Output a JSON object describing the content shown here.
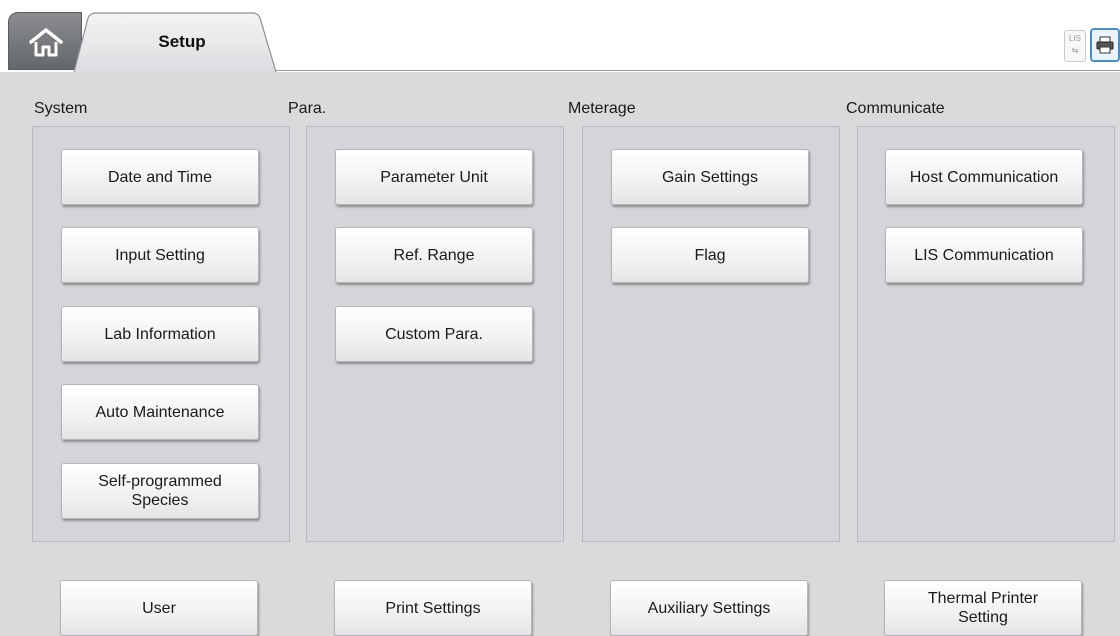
{
  "tabs": {
    "home_icon": "home-icon",
    "active_label": "Setup"
  },
  "toolbar": {
    "lis_label": "LIS",
    "lis_icon": "lis-transfer-icon",
    "printer_icon": "printer-icon"
  },
  "sections": {
    "system": {
      "title": "System",
      "buttons": [
        "Date and Time",
        "Input Setting",
        "Lab Information",
        "Auto Maintenance",
        "Self-programmed\nSpecies"
      ]
    },
    "para": {
      "title": "Para.",
      "buttons": [
        "Parameter Unit",
        "Ref. Range",
        "Custom Para."
      ]
    },
    "meterage": {
      "title": "Meterage",
      "buttons": [
        "Gain Settings",
        "Flag"
      ]
    },
    "communicate": {
      "title": "Communicate",
      "buttons": [
        "Host Communication",
        "LIS Communication"
      ]
    }
  },
  "bottom": {
    "buttons": [
      "User",
      "Print Settings",
      "Auxiliary Settings",
      "Thermal Printer\nSetting"
    ]
  }
}
